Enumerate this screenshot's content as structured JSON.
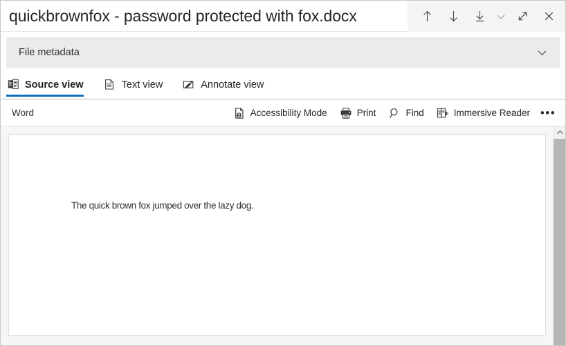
{
  "window": {
    "title": "quickbrownfox - password protected with fox.docx",
    "actions": [
      {
        "name": "previous-item-button",
        "icon": "arrow-up-icon",
        "label": "Previous"
      },
      {
        "name": "next-item-button",
        "icon": "arrow-down-icon",
        "label": "Next"
      },
      {
        "name": "download-button",
        "icon": "download-icon",
        "label": "Download"
      },
      {
        "name": "download-options-button",
        "icon": "chevron-down-icon",
        "label": "Download options"
      },
      {
        "name": "expand-button",
        "icon": "expand-diagonal-icon",
        "label": "Expand"
      },
      {
        "name": "close-button",
        "icon": "close-icon",
        "label": "Close"
      }
    ]
  },
  "metadata": {
    "label": "File metadata",
    "expander_icon": "chevron-down-icon"
  },
  "tabs": [
    {
      "label": "Source view",
      "icon": "source-pages-icon",
      "active": true
    },
    {
      "label": "Text view",
      "icon": "text-document-icon",
      "active": false
    },
    {
      "label": "Annotate view",
      "icon": "annotate-pencil-icon",
      "active": false
    }
  ],
  "commandbar": {
    "app_label": "Word",
    "buttons": [
      {
        "label": "Accessibility Mode",
        "icon": "accessibility-document-icon"
      },
      {
        "label": "Print",
        "icon": "printer-icon"
      },
      {
        "label": "Find",
        "icon": "search-icon"
      },
      {
        "label": "Immersive Reader",
        "icon": "immersive-reader-icon"
      }
    ],
    "more_label": "•••"
  },
  "document": {
    "body_text": "The quick brown fox jumped over the lazy dog."
  },
  "scrollbar": {
    "up_arrow_icon": "chevron-up-icon"
  },
  "colors": {
    "accent": "#0a6ebd",
    "titlebar_actions_bg": "#f4f4f4",
    "metadata_bg": "#ebebeb",
    "viewer_bg": "#f6f6f6",
    "scrollbar_thumb": "#b6b6b6"
  }
}
